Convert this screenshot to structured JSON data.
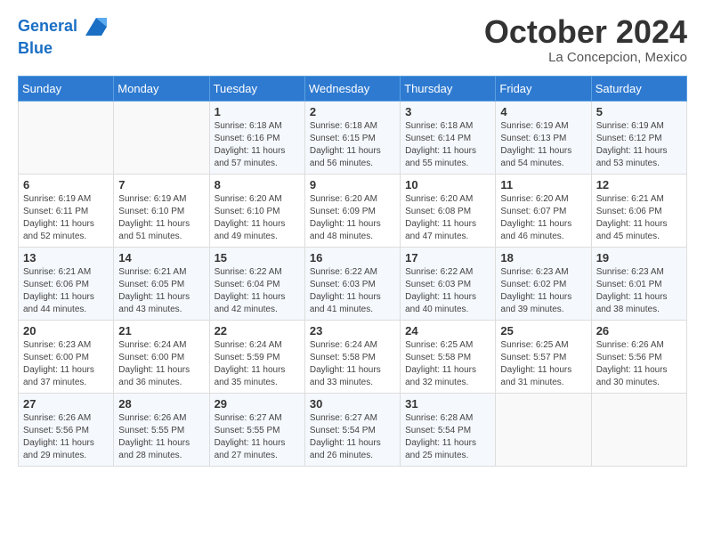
{
  "header": {
    "logo_line1": "General",
    "logo_line2": "Blue",
    "month": "October 2024",
    "location": "La Concepcion, Mexico"
  },
  "days_of_week": [
    "Sunday",
    "Monday",
    "Tuesday",
    "Wednesday",
    "Thursday",
    "Friday",
    "Saturday"
  ],
  "weeks": [
    [
      {
        "day": "",
        "sunrise": "",
        "sunset": "",
        "daylight": ""
      },
      {
        "day": "",
        "sunrise": "",
        "sunset": "",
        "daylight": ""
      },
      {
        "day": "1",
        "sunrise": "Sunrise: 6:18 AM",
        "sunset": "Sunset: 6:16 PM",
        "daylight": "Daylight: 11 hours and 57 minutes."
      },
      {
        "day": "2",
        "sunrise": "Sunrise: 6:18 AM",
        "sunset": "Sunset: 6:15 PM",
        "daylight": "Daylight: 11 hours and 56 minutes."
      },
      {
        "day": "3",
        "sunrise": "Sunrise: 6:18 AM",
        "sunset": "Sunset: 6:14 PM",
        "daylight": "Daylight: 11 hours and 55 minutes."
      },
      {
        "day": "4",
        "sunrise": "Sunrise: 6:19 AM",
        "sunset": "Sunset: 6:13 PM",
        "daylight": "Daylight: 11 hours and 54 minutes."
      },
      {
        "day": "5",
        "sunrise": "Sunrise: 6:19 AM",
        "sunset": "Sunset: 6:12 PM",
        "daylight": "Daylight: 11 hours and 53 minutes."
      }
    ],
    [
      {
        "day": "6",
        "sunrise": "Sunrise: 6:19 AM",
        "sunset": "Sunset: 6:11 PM",
        "daylight": "Daylight: 11 hours and 52 minutes."
      },
      {
        "day": "7",
        "sunrise": "Sunrise: 6:19 AM",
        "sunset": "Sunset: 6:10 PM",
        "daylight": "Daylight: 11 hours and 51 minutes."
      },
      {
        "day": "8",
        "sunrise": "Sunrise: 6:20 AM",
        "sunset": "Sunset: 6:10 PM",
        "daylight": "Daylight: 11 hours and 49 minutes."
      },
      {
        "day": "9",
        "sunrise": "Sunrise: 6:20 AM",
        "sunset": "Sunset: 6:09 PM",
        "daylight": "Daylight: 11 hours and 48 minutes."
      },
      {
        "day": "10",
        "sunrise": "Sunrise: 6:20 AM",
        "sunset": "Sunset: 6:08 PM",
        "daylight": "Daylight: 11 hours and 47 minutes."
      },
      {
        "day": "11",
        "sunrise": "Sunrise: 6:20 AM",
        "sunset": "Sunset: 6:07 PM",
        "daylight": "Daylight: 11 hours and 46 minutes."
      },
      {
        "day": "12",
        "sunrise": "Sunrise: 6:21 AM",
        "sunset": "Sunset: 6:06 PM",
        "daylight": "Daylight: 11 hours and 45 minutes."
      }
    ],
    [
      {
        "day": "13",
        "sunrise": "Sunrise: 6:21 AM",
        "sunset": "Sunset: 6:06 PM",
        "daylight": "Daylight: 11 hours and 44 minutes."
      },
      {
        "day": "14",
        "sunrise": "Sunrise: 6:21 AM",
        "sunset": "Sunset: 6:05 PM",
        "daylight": "Daylight: 11 hours and 43 minutes."
      },
      {
        "day": "15",
        "sunrise": "Sunrise: 6:22 AM",
        "sunset": "Sunset: 6:04 PM",
        "daylight": "Daylight: 11 hours and 42 minutes."
      },
      {
        "day": "16",
        "sunrise": "Sunrise: 6:22 AM",
        "sunset": "Sunset: 6:03 PM",
        "daylight": "Daylight: 11 hours and 41 minutes."
      },
      {
        "day": "17",
        "sunrise": "Sunrise: 6:22 AM",
        "sunset": "Sunset: 6:03 PM",
        "daylight": "Daylight: 11 hours and 40 minutes."
      },
      {
        "day": "18",
        "sunrise": "Sunrise: 6:23 AM",
        "sunset": "Sunset: 6:02 PM",
        "daylight": "Daylight: 11 hours and 39 minutes."
      },
      {
        "day": "19",
        "sunrise": "Sunrise: 6:23 AM",
        "sunset": "Sunset: 6:01 PM",
        "daylight": "Daylight: 11 hours and 38 minutes."
      }
    ],
    [
      {
        "day": "20",
        "sunrise": "Sunrise: 6:23 AM",
        "sunset": "Sunset: 6:00 PM",
        "daylight": "Daylight: 11 hours and 37 minutes."
      },
      {
        "day": "21",
        "sunrise": "Sunrise: 6:24 AM",
        "sunset": "Sunset: 6:00 PM",
        "daylight": "Daylight: 11 hours and 36 minutes."
      },
      {
        "day": "22",
        "sunrise": "Sunrise: 6:24 AM",
        "sunset": "Sunset: 5:59 PM",
        "daylight": "Daylight: 11 hours and 35 minutes."
      },
      {
        "day": "23",
        "sunrise": "Sunrise: 6:24 AM",
        "sunset": "Sunset: 5:58 PM",
        "daylight": "Daylight: 11 hours and 33 minutes."
      },
      {
        "day": "24",
        "sunrise": "Sunrise: 6:25 AM",
        "sunset": "Sunset: 5:58 PM",
        "daylight": "Daylight: 11 hours and 32 minutes."
      },
      {
        "day": "25",
        "sunrise": "Sunrise: 6:25 AM",
        "sunset": "Sunset: 5:57 PM",
        "daylight": "Daylight: 11 hours and 31 minutes."
      },
      {
        "day": "26",
        "sunrise": "Sunrise: 6:26 AM",
        "sunset": "Sunset: 5:56 PM",
        "daylight": "Daylight: 11 hours and 30 minutes."
      }
    ],
    [
      {
        "day": "27",
        "sunrise": "Sunrise: 6:26 AM",
        "sunset": "Sunset: 5:56 PM",
        "daylight": "Daylight: 11 hours and 29 minutes."
      },
      {
        "day": "28",
        "sunrise": "Sunrise: 6:26 AM",
        "sunset": "Sunset: 5:55 PM",
        "daylight": "Daylight: 11 hours and 28 minutes."
      },
      {
        "day": "29",
        "sunrise": "Sunrise: 6:27 AM",
        "sunset": "Sunset: 5:55 PM",
        "daylight": "Daylight: 11 hours and 27 minutes."
      },
      {
        "day": "30",
        "sunrise": "Sunrise: 6:27 AM",
        "sunset": "Sunset: 5:54 PM",
        "daylight": "Daylight: 11 hours and 26 minutes."
      },
      {
        "day": "31",
        "sunrise": "Sunrise: 6:28 AM",
        "sunset": "Sunset: 5:54 PM",
        "daylight": "Daylight: 11 hours and 25 minutes."
      },
      {
        "day": "",
        "sunrise": "",
        "sunset": "",
        "daylight": ""
      },
      {
        "day": "",
        "sunrise": "",
        "sunset": "",
        "daylight": ""
      }
    ]
  ]
}
